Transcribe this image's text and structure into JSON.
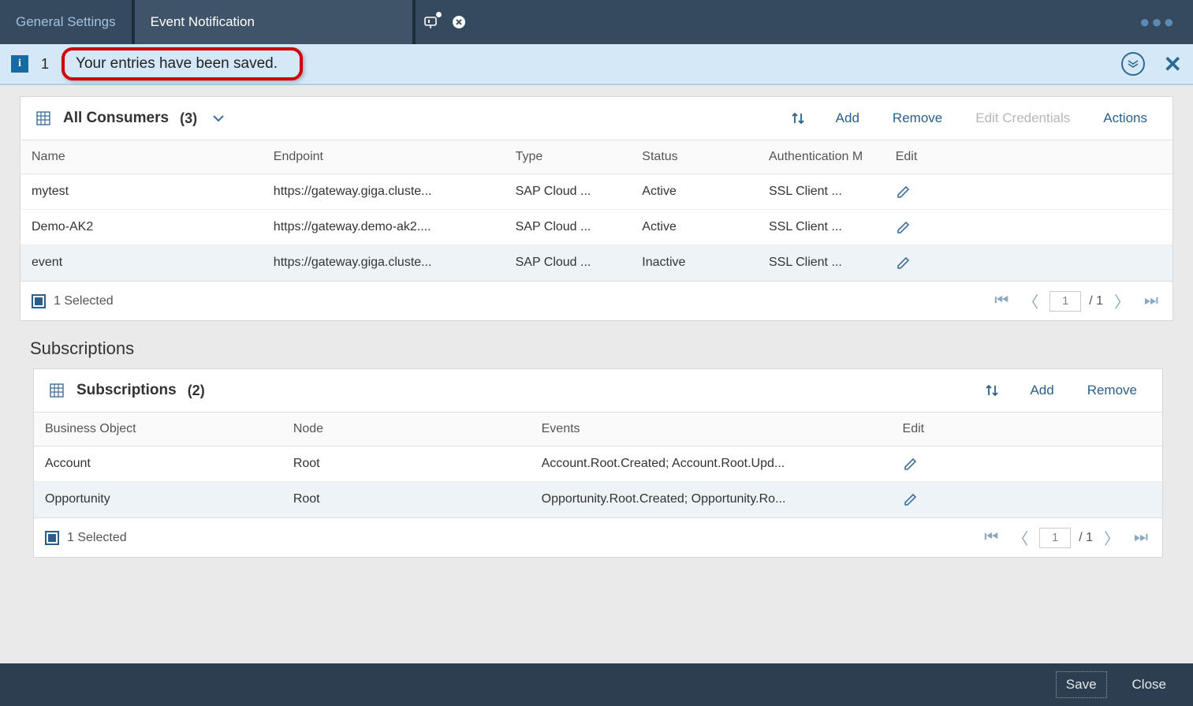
{
  "tabs": {
    "general": "General Settings",
    "active": "Event Notification"
  },
  "msgbar": {
    "count": "1",
    "text": "Your entries have been saved."
  },
  "consumers": {
    "title": "All Consumers",
    "count": "(3)",
    "toolbar": {
      "add": "Add",
      "remove": "Remove",
      "editCred": "Edit Credentials",
      "actions": "Actions"
    },
    "cols": [
      "Name",
      "Endpoint",
      "Type",
      "Status",
      "Authentication M",
      "Edit"
    ],
    "rows": [
      {
        "name": "mytest",
        "endpoint": "https://gateway.giga.cluste...",
        "type": "SAP Cloud ...",
        "status": "Active",
        "auth": "SSL Client ...",
        "selected": false
      },
      {
        "name": "Demo-AK2",
        "endpoint": "https://gateway.demo-ak2....",
        "type": "SAP Cloud ...",
        "status": "Active",
        "auth": "SSL Client ...",
        "selected": false
      },
      {
        "name": "event",
        "endpoint": "https://gateway.giga.cluste...",
        "type": "SAP Cloud ...",
        "status": "Inactive",
        "auth": "SSL Client ...",
        "selected": true
      }
    ],
    "footer": {
      "selected": "1 Selected",
      "page": "1",
      "total": "/ 1"
    }
  },
  "subsSection": "Subscriptions",
  "subs": {
    "title": "Subscriptions",
    "count": "(2)",
    "toolbar": {
      "add": "Add",
      "remove": "Remove"
    },
    "cols": [
      "Business Object",
      "Node",
      "Events",
      "Edit"
    ],
    "rows": [
      {
        "bo": "Account",
        "node": "Root",
        "events": "Account.Root.Created; Account.Root.Upd...",
        "selected": false
      },
      {
        "bo": "Opportunity",
        "node": "Root",
        "events": "Opportunity.Root.Created; Opportunity.Ro...",
        "selected": true
      }
    ],
    "footer": {
      "selected": "1 Selected",
      "page": "1",
      "total": "/ 1"
    }
  },
  "footer": {
    "save": "Save",
    "close": "Close"
  }
}
